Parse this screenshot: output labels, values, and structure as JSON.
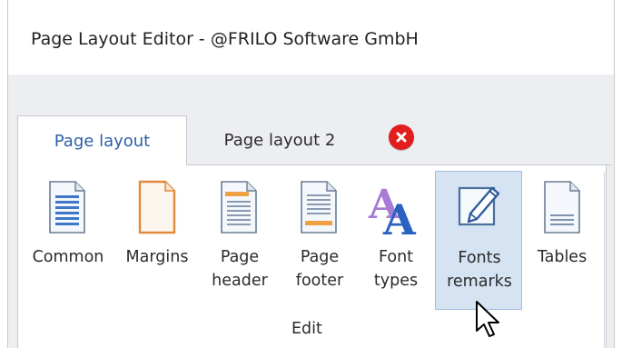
{
  "window": {
    "title": "Page Layout Editor - @FRILO Software GmbH"
  },
  "tabs": [
    {
      "label": "Page layout",
      "active": true
    },
    {
      "label": "Page layout 2",
      "active": false
    }
  ],
  "close_tab_icon": "close-circle-icon",
  "ribbon": {
    "group_label": "Edit",
    "buttons": [
      {
        "label_line1": "Common",
        "label_line2": "",
        "icon": "document-lines-icon"
      },
      {
        "label_line1": "Margins",
        "label_line2": "",
        "icon": "page-margins-icon"
      },
      {
        "label_line1": "Page",
        "label_line2": "header",
        "icon": "page-header-icon"
      },
      {
        "label_line1": "Page",
        "label_line2": "footer",
        "icon": "page-footer-icon"
      },
      {
        "label_line1": "Font",
        "label_line2": "types",
        "icon": "font-types-icon"
      },
      {
        "label_line1": "Fonts",
        "label_line2": "remarks",
        "icon": "edit-pen-icon",
        "hovered": true
      },
      {
        "label_line1": "Tables",
        "label_line2": "",
        "icon": "table-page-icon"
      }
    ]
  },
  "colors": {
    "accent_tab_text": "#2d5fa7",
    "hover_fill": "#d5e3f2",
    "hover_border": "#9fbddf",
    "close_red": "#e21d1d",
    "ribbon_bg": "#eceef1"
  },
  "cursor": "arrow-pointer-icon"
}
